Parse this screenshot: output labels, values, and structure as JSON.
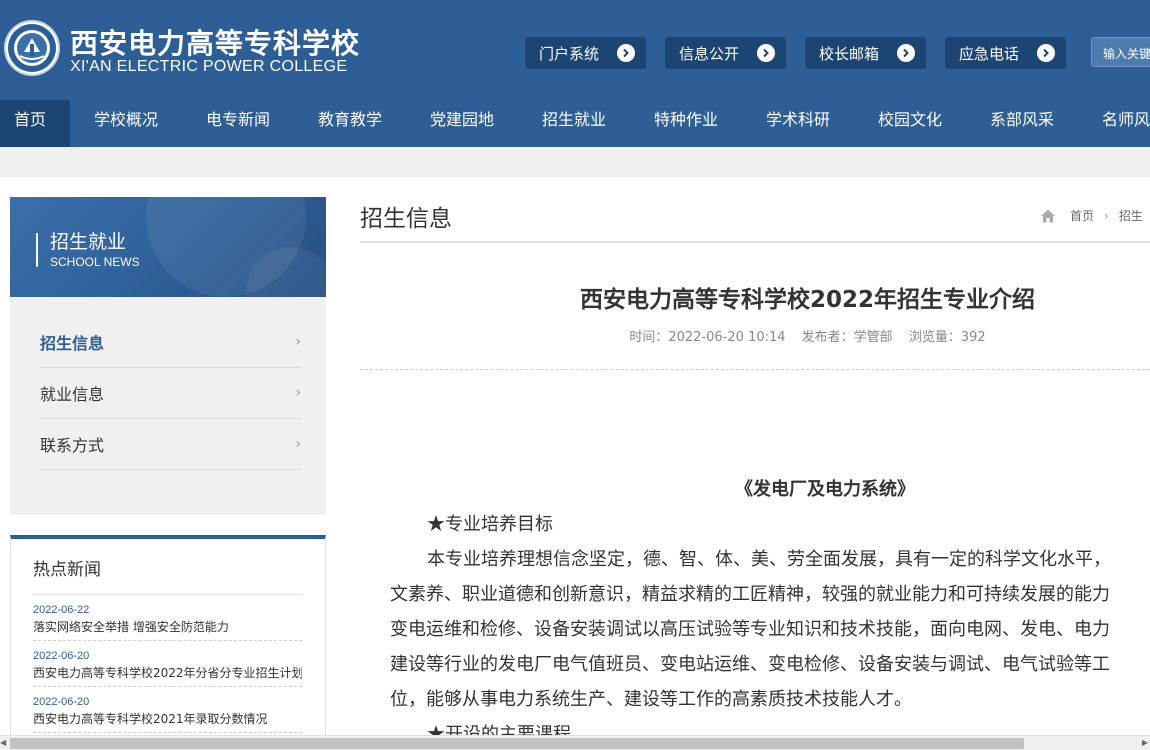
{
  "header": {
    "college_cn": "西安电力高等专科学校",
    "college_en": "XI'AN ELECTRIC POWER COLLEGE",
    "quick_links": [
      "门户系统",
      "信息公开",
      "校长邮箱",
      "应急电话"
    ],
    "search_placeholder": "输入关键"
  },
  "nav": {
    "items": [
      "首页",
      "学校概况",
      "电专新闻",
      "教育教学",
      "党建园地",
      "招生就业",
      "特种作业",
      "学术科研",
      "校园文化",
      "系部风采",
      "名师风"
    ]
  },
  "sidebar": {
    "title": "招生就业",
    "subtitle": "SCHOOL NEWS",
    "menu": [
      "招生信息",
      "就业信息",
      "联系方式"
    ],
    "chevron": "›"
  },
  "hot_news": {
    "title": "热点新闻",
    "items": [
      {
        "date": "2022-06-22",
        "text": "落实网络安全举措 增强安全防范能力"
      },
      {
        "date": "2022-06-20",
        "text": "西安电力高等专科学校2022年分省分专业招生计划"
      },
      {
        "date": "2022-06-20",
        "text": "西安电力高等专科学校2021年录取分数情况"
      }
    ]
  },
  "main": {
    "section_title": "招生信息",
    "breadcrumb": [
      "首页",
      "招生"
    ],
    "breadcrumb_sep": "›",
    "article_title": "西安电力高等专科学校2022年招生专业介绍",
    "meta": {
      "time": "时间：2022-06-20 10:14",
      "publisher": "发布者：学管部",
      "views": "浏览量：392"
    },
    "body": {
      "heading": "《发电厂及电力系统》",
      "sub1": "★专业培养目标",
      "lines": [
        "本专业培养理想信念坚定，德、智、体、美、劳全面发展，具有一定的科学文化水平，",
        "文素养、职业道德和创新意识，精益求精的工匠精神，较强的就业能力和可持续发展的能力",
        "变电运维和检修、设备安装调试以高压试验等专业知识和技术技能，面向电网、发电、电力",
        "建设等行业的发电厂电气值班员、变电站运维、变电检修、设备安装与调试、电气试验等工",
        "位，能够从事电力系统生产、建设等工作的高素质技术技能人才。"
      ],
      "sub2": "★开设的主要课程"
    }
  },
  "colors": {
    "primary": "#2d5e96",
    "dark": "#1d4574",
    "band": "#f0f0f0"
  }
}
